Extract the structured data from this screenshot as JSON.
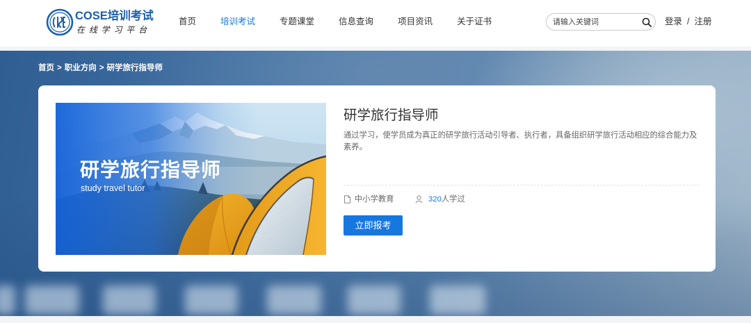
{
  "header": {
    "logo_icon": "cose-emblem-logo-icon",
    "brand": "COSE培训考试",
    "slogan": "在 线 学 习 平 台",
    "nav": [
      {
        "label": "首页",
        "active": false
      },
      {
        "label": "培训考试",
        "active": true
      },
      {
        "label": "专题课堂",
        "active": false
      },
      {
        "label": "信息查询",
        "active": false
      },
      {
        "label": "项目资讯",
        "active": false
      },
      {
        "label": "关于证书",
        "active": false
      }
    ],
    "search": {
      "placeholder": "请输入关键词",
      "icon": "search-icon"
    },
    "auth": {
      "login": "登录",
      "separator": "/",
      "register": "注册"
    }
  },
  "breadcrumb": {
    "items": [
      "首页",
      "职业方向",
      "研学旅行指导师"
    ],
    "separator": ">"
  },
  "course": {
    "cover": {
      "title": "研学旅行指导师",
      "subtitle": "study travel tutor"
    },
    "title": "研学旅行指导师",
    "description": "通过学习，使学员成为真正的研学旅行活动引导者、执行者，具备组织研学旅行活动相应的综合能力及素养。",
    "category": {
      "icon": "document-icon",
      "label": "中小学教育"
    },
    "learners": {
      "icon": "user-icon",
      "count": "320",
      "suffix": "人学过"
    },
    "enroll_label": "立即报考"
  },
  "colors": {
    "accent": "#1677e0",
    "brand": "#1b5fae"
  }
}
